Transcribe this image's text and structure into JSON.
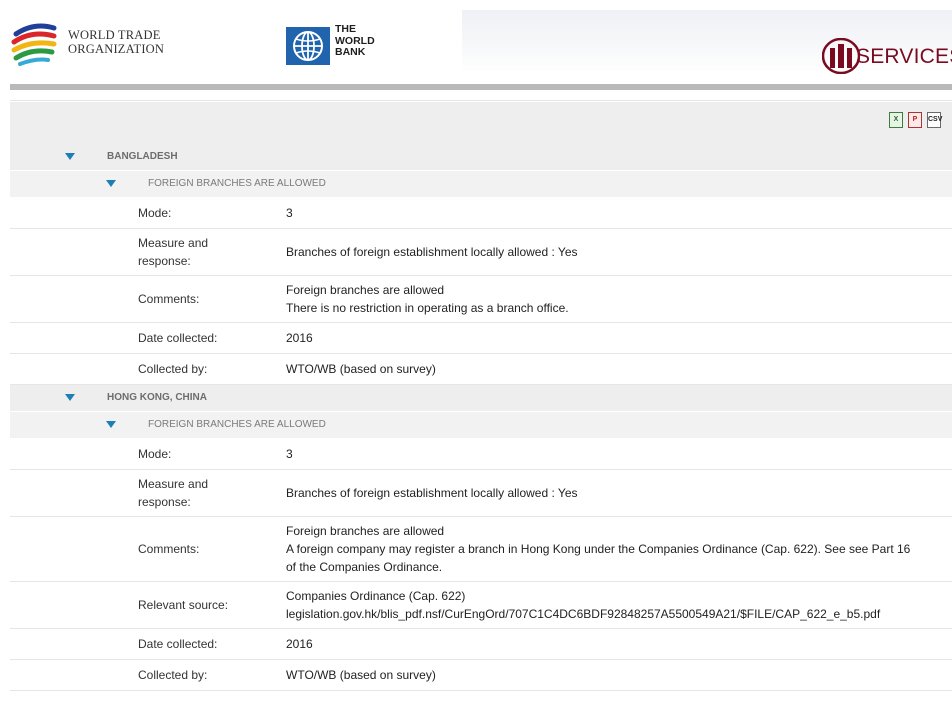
{
  "header": {
    "wto_line1": "World Trade",
    "wto_line2": "Organization",
    "wb_line1": "THE",
    "wb_line2": "WORLD",
    "wb_line3": "BANK",
    "services_text": "SERVICES"
  },
  "toolbar": {
    "icons": [
      "excel-export-icon",
      "pdf-export-icon",
      "csv-export-icon"
    ],
    "csv_label": "CSV"
  },
  "countries": [
    {
      "name": "BANGLADESH",
      "measures": [
        {
          "title": "FOREIGN BRANCHES ARE ALLOWED",
          "rows": [
            {
              "label": "Mode:",
              "lines": [
                "3"
              ],
              "height": "h1"
            },
            {
              "label": "Measure and response:",
              "lines": [
                "Branches of foreign establishment locally allowed : Yes"
              ],
              "height": "h2"
            },
            {
              "label": "Comments:",
              "lines": [
                "Foreign branches are allowed",
                "There is no restriction in operating as a branch office."
              ],
              "height": "h2"
            },
            {
              "label": "Date collected:",
              "lines": [
                "2016"
              ],
              "height": "h1"
            },
            {
              "label": "Collected by:",
              "lines": [
                "WTO/WB (based on survey)"
              ],
              "height": "h1"
            }
          ]
        }
      ]
    },
    {
      "name": "HONG KONG, CHINA",
      "measures": [
        {
          "title": "FOREIGN BRANCHES ARE ALLOWED",
          "rows": [
            {
              "label": "Mode:",
              "lines": [
                "3"
              ],
              "height": "h1"
            },
            {
              "label": "Measure and response:",
              "lines": [
                "Branches of foreign establishment locally allowed : Yes"
              ],
              "height": "h2"
            },
            {
              "label": "Comments:",
              "lines": [
                "Foreign branches are allowed",
                "A foreign company may register a branch in Hong Kong under the Companies Ordinance (Cap. 622). See see Part 16",
                "of the Companies Ordinance."
              ],
              "height": "h3"
            },
            {
              "label": "Relevant source:",
              "lines": [
                "Companies Ordinance (Cap. 622)",
                "legislation.gov.hk/blis_pdf.nsf/CurEngOrd/707C1C4DC6BDF92848257A5500549A21/$FILE/CAP_622_e_b5.pdf"
              ],
              "height": "h2"
            },
            {
              "label": "Date collected:",
              "lines": [
                "2016"
              ],
              "height": "h1"
            },
            {
              "label": "Collected by:",
              "lines": [
                "WTO/WB (based on survey)"
              ],
              "height": "h1"
            }
          ]
        }
      ]
    }
  ],
  "colors": {
    "accent_triangle": "#1d7fb6",
    "services_brand": "#7a0a20",
    "row_bg": "#eeeeee"
  }
}
